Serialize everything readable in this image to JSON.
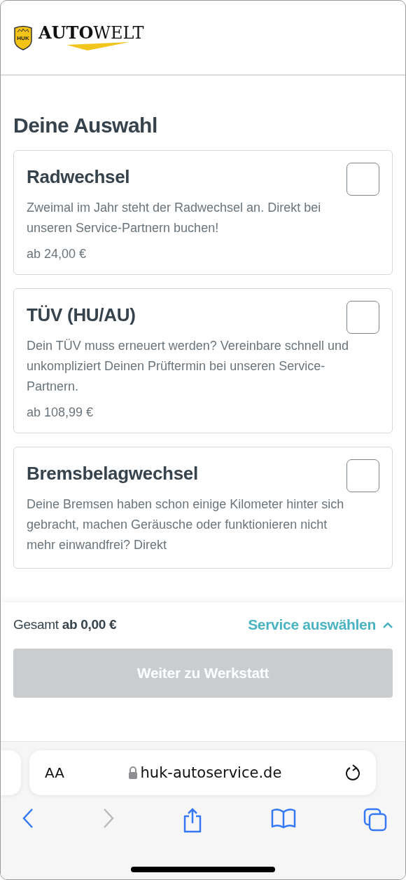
{
  "header": {
    "logo_badge": "HUK",
    "logo_bold": "AUTO",
    "logo_light": "WELT"
  },
  "title": "Deine Auswahl",
  "services": [
    {
      "name": "Radwechsel",
      "description": "Zweimal im Jahr steht der Radwechsel an. Direkt bei unseren Service-Partnern buchen!",
      "price": "ab 24,00 €",
      "checked": false
    },
    {
      "name": "TÜV (HU/AU)",
      "description": "Dein TÜV muss erneuert werden? Vereinbare schnell und unkompliziert Deinen Prüftermin bei unseren Service-Partnern.",
      "price": "ab 108,99 €",
      "checked": false
    },
    {
      "name": "Bremsbelagwechsel",
      "description": "Deine Bremsen haben schon einige Kilometer hinter sich gebracht, machen Geräusche oder funktionieren nicht mehr einwandfrei? Direkt",
      "checked": false
    }
  ],
  "footer": {
    "total_label": "Gesamt",
    "total_value": "ab 0,00 €",
    "toggle": "Service auswählen",
    "expanded": false,
    "button": "Weiter zu Werkstatt",
    "button_disabled": true
  },
  "browser": {
    "text_size": "AA",
    "url": "huk-autoservice.de",
    "back_disabled": false,
    "forward_disabled": true
  }
}
